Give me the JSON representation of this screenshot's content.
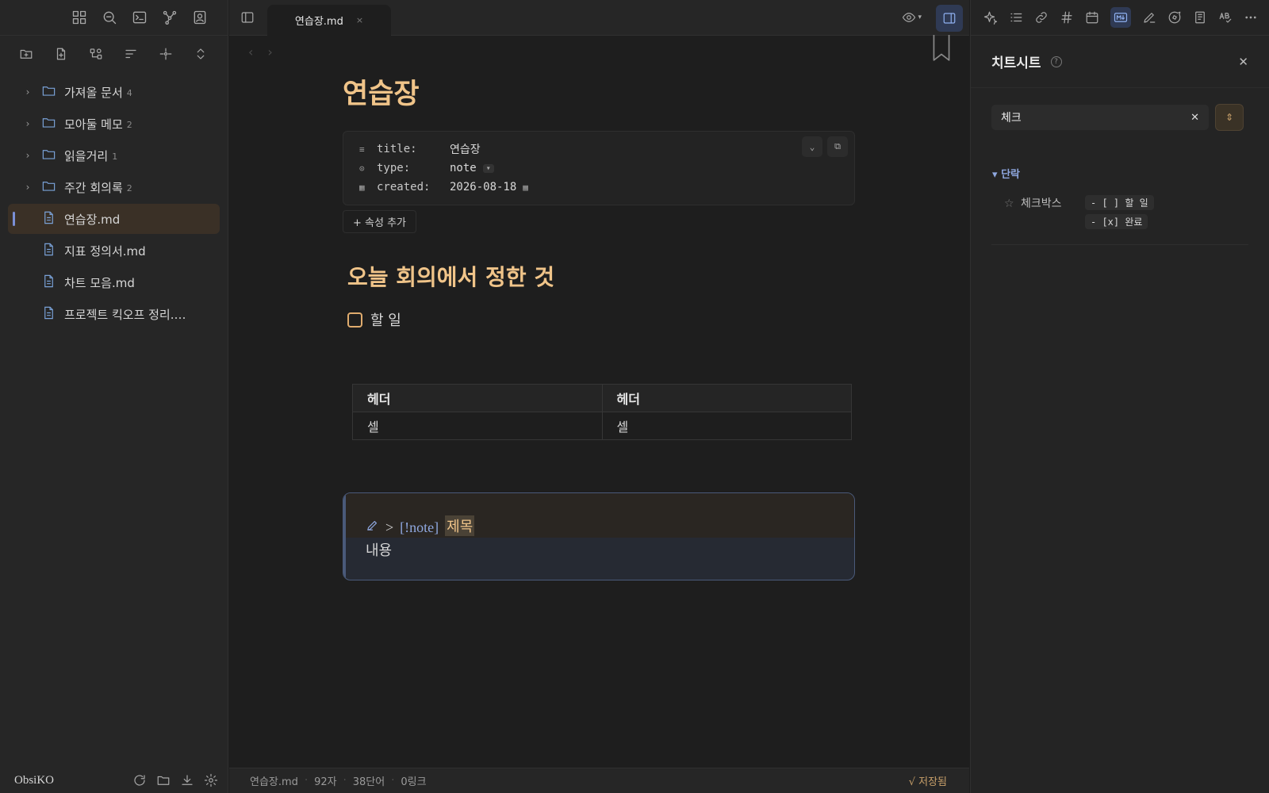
{
  "app": {
    "vault_name": "ObsiKO",
    "accent_color": "#f0c489",
    "link_color": "#8fa8e0"
  },
  "left_sidebar": {
    "top_icons": [
      "layout-icon",
      "search-icon",
      "terminal-icon",
      "graph-icon",
      "contact-icon"
    ],
    "toolbar_icons": [
      "new-folder-icon",
      "new-note-icon",
      "canvas-icon",
      "sort-icon",
      "reveal-icon",
      "collapse-icon"
    ],
    "tree": [
      {
        "type": "folder",
        "label": "가져올 문서",
        "count": "4"
      },
      {
        "type": "folder",
        "label": "모아둘 메모",
        "count": "2"
      },
      {
        "type": "folder",
        "label": "읽을거리",
        "count": "1"
      },
      {
        "type": "folder",
        "label": "주간 회의록",
        "count": "2"
      },
      {
        "type": "file",
        "label": "연습장.md",
        "active": true
      },
      {
        "type": "file",
        "label": "지표 정의서.md"
      },
      {
        "type": "file",
        "label": "차트 모음.md"
      },
      {
        "type": "file",
        "label": "프로젝트 킥오프 정리.…"
      }
    ]
  },
  "tab": {
    "label": "연습장.md",
    "close": "×"
  },
  "doc": {
    "title": "연습장",
    "properties": [
      {
        "key": "title:",
        "value": "연습장"
      },
      {
        "key": "type:",
        "value": "note"
      },
      {
        "key": "created:",
        "value": "2026-08-18"
      }
    ],
    "add_property": "+ 속성 추가",
    "heading": "오늘 회의에서 정한 것",
    "todo": "할 일",
    "table": {
      "headers": [
        "헤더",
        "헤더"
      ],
      "rows": [
        [
          "셀",
          "셀"
        ]
      ]
    },
    "callout": {
      "marker": ">",
      "type": "[!note]",
      "title": "제목",
      "body": "내용"
    }
  },
  "statusbar": {
    "file": "연습장.md",
    "chars": "92자",
    "words": "38단어",
    "links": "0링크",
    "saved": "√ 저장됨"
  },
  "right_panel": {
    "toolbar_icons": [
      "sparkle-icon",
      "list-icon",
      "link-icon",
      "hashtag-icon",
      "calendar-icon",
      "markdown-icon",
      "edit-icon",
      "comment-icon",
      "book-icon",
      "spellcheck-icon",
      "more-icon"
    ],
    "title": "치트시트",
    "help": "?",
    "close": "✕",
    "search": {
      "value": "체크",
      "clear": "✕"
    },
    "section": "단락",
    "entries": [
      {
        "name": "체크박스",
        "star": "☆",
        "code": [
          "- [ ] 할 일",
          "- [x] 완료"
        ]
      }
    ]
  }
}
